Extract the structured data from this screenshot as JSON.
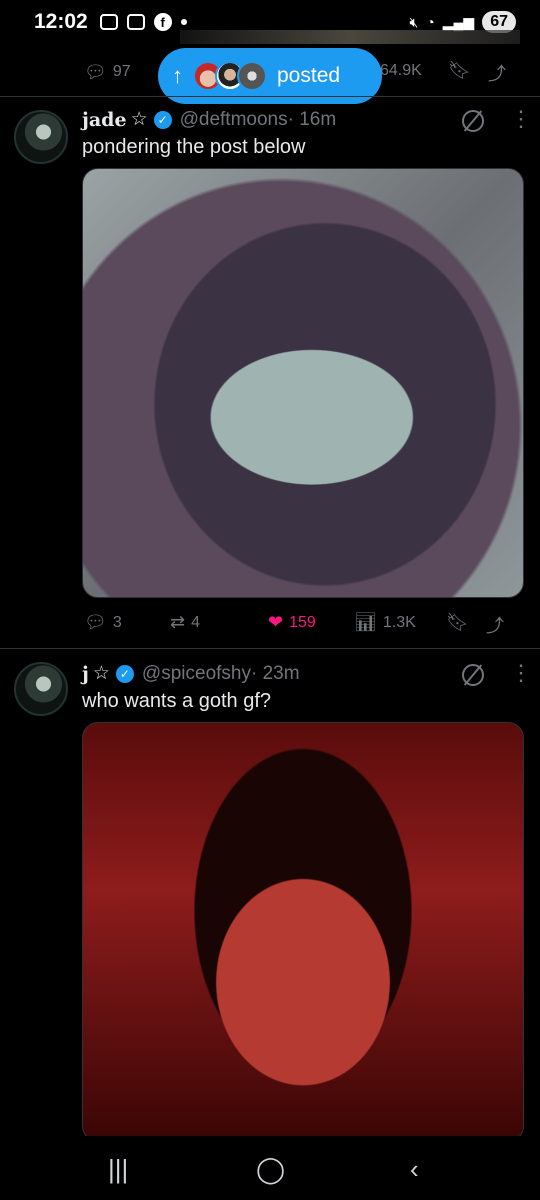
{
  "status_bar": {
    "time": "12:02",
    "battery": "67",
    "left_icons": [
      "screen-record-icon",
      "app-icon",
      "facebook-icon"
    ],
    "right_icons": [
      "mute-icon",
      "wifi-icon",
      "signal-icon"
    ]
  },
  "prev_tweet": {
    "replies": "97",
    "views": "64.9K"
  },
  "new_posts_pill": {
    "label": "posted",
    "arrow": "↑"
  },
  "tweets": [
    {
      "name": "jade",
      "star": "☆",
      "handle": "@deftmoons",
      "time": "· 16m",
      "text": "pondering the post below",
      "replies": "3",
      "retweets": "4",
      "likes": "159",
      "views": "1.3K"
    },
    {
      "name": "j",
      "star": "☆",
      "handle": "@spiceofshy",
      "time": "· 23m",
      "text": "who wants a goth gf?"
    }
  ],
  "colors": {
    "accent": "#1d9bf0",
    "like": "#f91880",
    "muted": "#71767b"
  }
}
